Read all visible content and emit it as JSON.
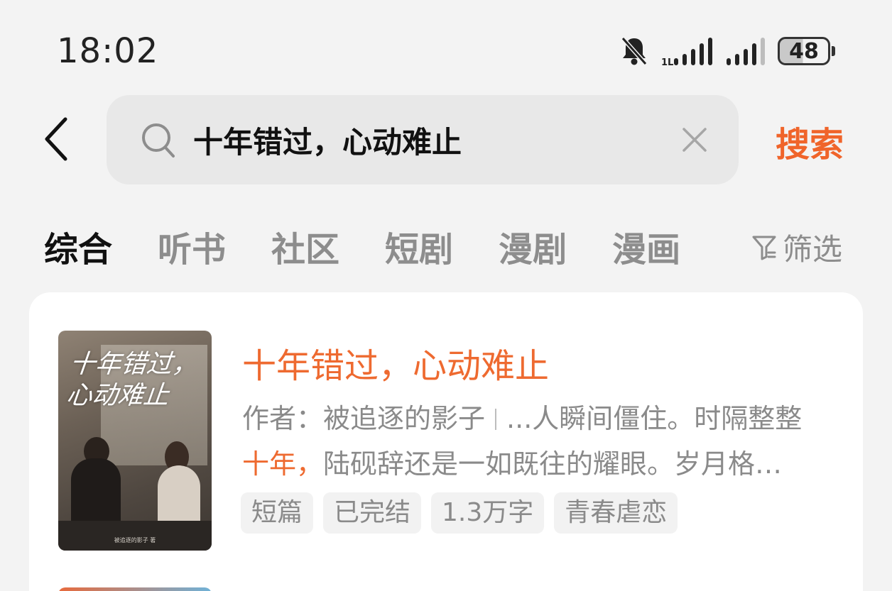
{
  "status_bar": {
    "time": "18:02",
    "icons": [
      "bell-muted-icon",
      "signal-icon",
      "signal-icon"
    ],
    "battery": "48",
    "battery_level": 0.48
  },
  "search": {
    "query": "十年错过，心动难止",
    "button_label": "搜索"
  },
  "tabs": [
    {
      "label": "综合",
      "active": true
    },
    {
      "label": "听书",
      "active": false
    },
    {
      "label": "社区",
      "active": false
    },
    {
      "label": "短剧",
      "active": false
    },
    {
      "label": "漫剧",
      "active": false
    },
    {
      "label": "漫画",
      "active": false
    }
  ],
  "filter_label": "筛选",
  "result": {
    "title": "十年错过，心动难止",
    "cover_title": "十年错过，心动难止",
    "cover_author": "被追逐的影子 著",
    "author_prefix": "作者：",
    "author": "被追逐的影子",
    "snippet_line1": "...人瞬间僵住。时隔整整",
    "snippet_highlight": "十年，",
    "snippet_line2": "陆砚辞还是一如既往的耀眼。岁月格…",
    "tags": [
      "短篇",
      "已完结",
      "1.3万字",
      "青春虐恋"
    ]
  },
  "colors": {
    "accent": "#ee6a30",
    "background": "#f3f3f3",
    "card": "#ffffff"
  }
}
